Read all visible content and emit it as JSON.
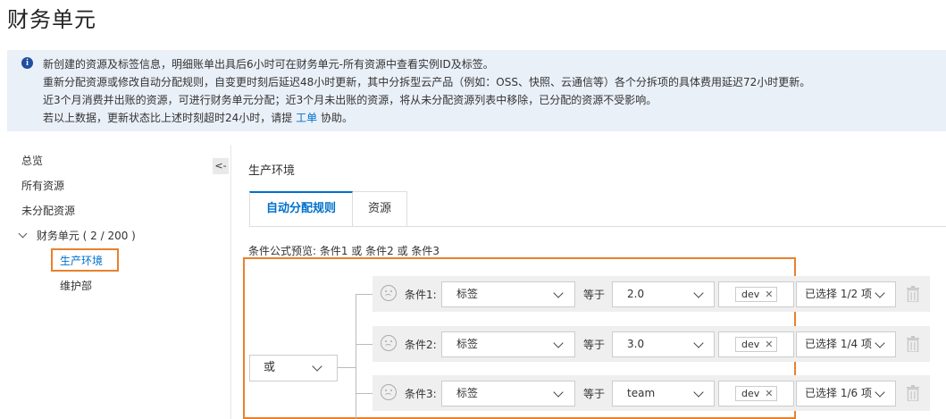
{
  "page": {
    "title": "财务单元"
  },
  "notice": {
    "icon": "info-icon",
    "line1": "新创建的资源及标签信息，明细账单出具后6小时可在财务单元-所有资源中查看实例ID及标签。",
    "line2": "重新分配资源或修改自动分配规则，自变更时刻后延迟48小时更新，其中分拆型云产品（例如：OSS、快照、云通信等）各个分拆项的具体费用延迟72小时更新。",
    "line3": "近3个月消费并出账的资源，可进行财务单元分配；近3个月未出账的资源，将从未分配资源列表中移除，已分配的资源不受影响。",
    "line4_prefix": "若以上数据，更新状态比上述时刻超时24小时，请提",
    "line4_link": "工单",
    "line4_suffix": "协助。"
  },
  "sidebar": {
    "overview": "总览",
    "all_resources": "所有资源",
    "unallocated": "未分配资源",
    "finance_units": "财务单元 ( 2 / 200 )",
    "children": [
      "生产环境",
      "维护部"
    ],
    "collapse": "<-"
  },
  "main": {
    "section_title": "生产环境",
    "tabs": [
      "自动分配规则",
      "资源"
    ],
    "formula": "条件公式预览:  条件1 或 条件2 或 条件3",
    "logic_operator": "或",
    "conditions": [
      {
        "label": "条件1:",
        "type": "标签",
        "equals": "等于",
        "key": "2.0",
        "tag": "dev",
        "count": "已选择 1/2 项"
      },
      {
        "label": "条件2:",
        "type": "标签",
        "equals": "等于",
        "key": "3.0",
        "tag": "dev",
        "count": "已选择 1/4 项"
      },
      {
        "label": "条件3:",
        "type": "标签",
        "equals": "等于",
        "key": "team",
        "tag": "dev",
        "count": "已选择 1/6 项"
      }
    ]
  },
  "colors": {
    "accent": "#0070cc",
    "highlight": "#e8812c",
    "notice_bg": "#eaf0f8",
    "row_bg": "#efefef"
  }
}
